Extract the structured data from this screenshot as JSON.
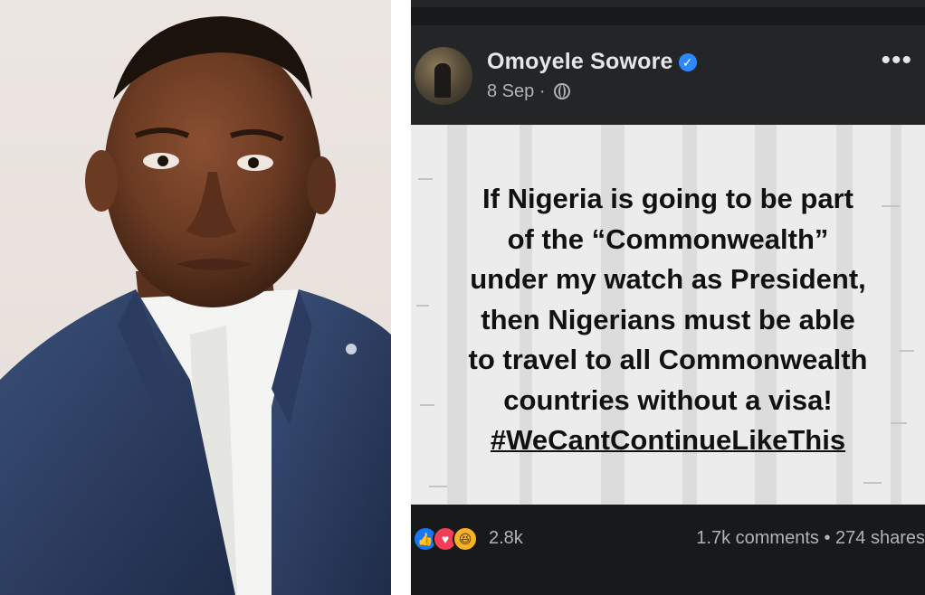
{
  "post": {
    "author": "Omoyele Sowore",
    "date": "8 Sep",
    "separator": "·",
    "body_lines": [
      "If Nigeria is going to be part",
      "of the “Commonwealth”",
      "under my watch as President,",
      "then Nigerians must be able",
      "to travel to all Commonwealth",
      "countries without a visa!"
    ],
    "hashtag": "#WeCantContinueLikeThis",
    "reaction_count": "2.8k",
    "comments": "1.7k comments",
    "stats_separator": "•",
    "shares": "274 shares"
  },
  "icons": {
    "verified": "verified-badge-icon",
    "audience": "globe-icon",
    "more": "more-options-icon",
    "reactions": [
      "like-icon",
      "love-icon",
      "haha-icon"
    ]
  },
  "colors": {
    "background_dark": "#18191a",
    "header_dark": "#242526",
    "verified_blue": "#2d88ff",
    "like_blue": "#1877f2",
    "love_red": "#f33e58",
    "haha_yellow": "#f7b125",
    "text_primary": "#e4e6eb",
    "text_secondary": "#b0b3b8"
  }
}
